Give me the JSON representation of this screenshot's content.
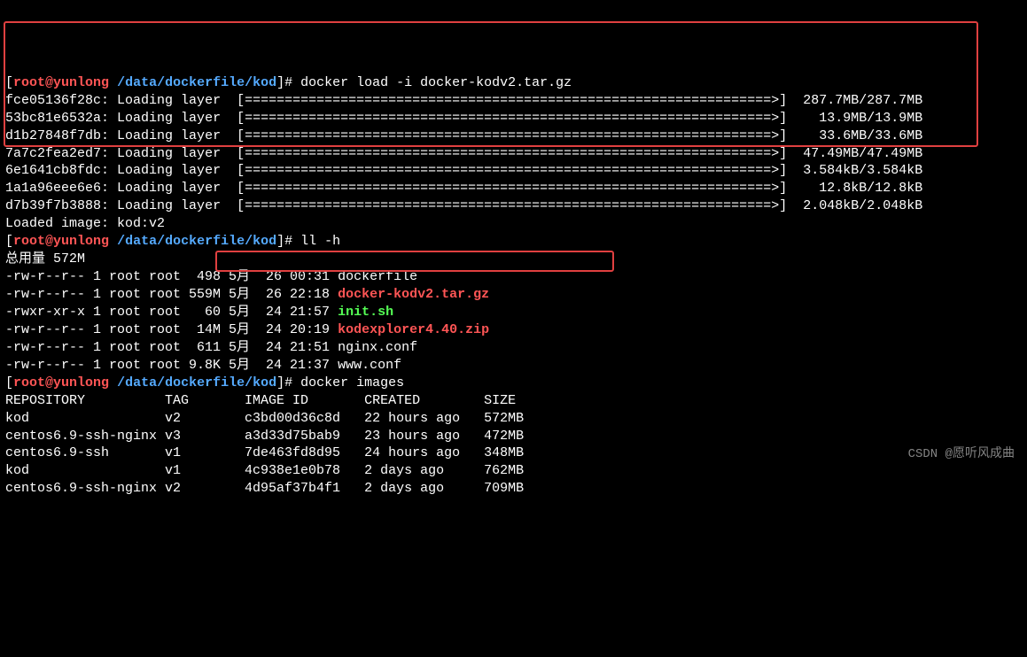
{
  "prompt": {
    "bracket_open": "[",
    "user_host": "root@yunlong",
    "path": "/data/dockerfile/kod",
    "bracket_close": "]#"
  },
  "commands": {
    "load": "docker load -i docker-kodv2.tar.gz",
    "ll": "ll -h",
    "images": "docker images"
  },
  "layers": [
    {
      "id": "fce05136f28c",
      "label": "Loading layer",
      "bar": "[==================================================================>]",
      "size": "287.7MB/287.7MB"
    },
    {
      "id": "53bc81e6532a",
      "label": "Loading layer",
      "bar": "[==================================================================>]",
      "size": "13.9MB/13.9MB"
    },
    {
      "id": "d1b27848f7db",
      "label": "Loading layer",
      "bar": "[==================================================================>]",
      "size": "33.6MB/33.6MB"
    },
    {
      "id": "7a7c2fea2ed7",
      "label": "Loading layer",
      "bar": "[==================================================================>]",
      "size": "47.49MB/47.49MB"
    },
    {
      "id": "6e1641cb8fdc",
      "label": "Loading layer",
      "bar": "[==================================================================>]",
      "size": "3.584kB/3.584kB"
    },
    {
      "id": "1a1a96eee6e6",
      "label": "Loading layer",
      "bar": "[==================================================================>]",
      "size": "12.8kB/12.8kB"
    },
    {
      "id": "d7b39f7b3888",
      "label": "Loading layer",
      "bar": "[==================================================================>]",
      "size": "2.048kB/2.048kB"
    }
  ],
  "loaded_image": "Loaded image: kod:v2",
  "ll_total": "总用量 572M",
  "files": [
    {
      "perm": "-rw-r--r-- 1 root root  498 5月  26 00:31 ",
      "name": "dockerfile",
      "cls": "white"
    },
    {
      "perm": "-rw-r--r-- 1 root root 559M 5月  26 22:18 ",
      "name": "docker-kodv2.tar.gz",
      "cls": "red"
    },
    {
      "perm": "-rwxr-xr-x 1 root root   60 5月  24 21:57 ",
      "name": "init.sh",
      "cls": "green"
    },
    {
      "perm": "-rw-r--r-- 1 root root  14M 5月  24 20:19 ",
      "name": "kodexplorer4.40.zip",
      "cls": "red"
    },
    {
      "perm": "-rw-r--r-- 1 root root  611 5月  24 21:51 ",
      "name": "nginx.conf",
      "cls": "white"
    },
    {
      "perm": "-rw-r--r-- 1 root root 9.8K 5月  24 21:37 ",
      "name": "www.conf",
      "cls": "white"
    }
  ],
  "images_header": "REPOSITORY          TAG       IMAGE ID       CREATED        SIZE",
  "images": [
    "kod                 v2        c3bd00d36c8d   22 hours ago   572MB",
    "centos6.9-ssh-nginx v3        a3d33d75bab9   23 hours ago   472MB",
    "centos6.9-ssh       v1        7de463fd8d95   24 hours ago   348MB",
    "kod                 v1        4c938e1e0b78   2 days ago     762MB",
    "centos6.9-ssh-nginx v2        4d95af37b4f1   2 days ago     709MB"
  ],
  "watermark": "CSDN @愿听风成曲"
}
